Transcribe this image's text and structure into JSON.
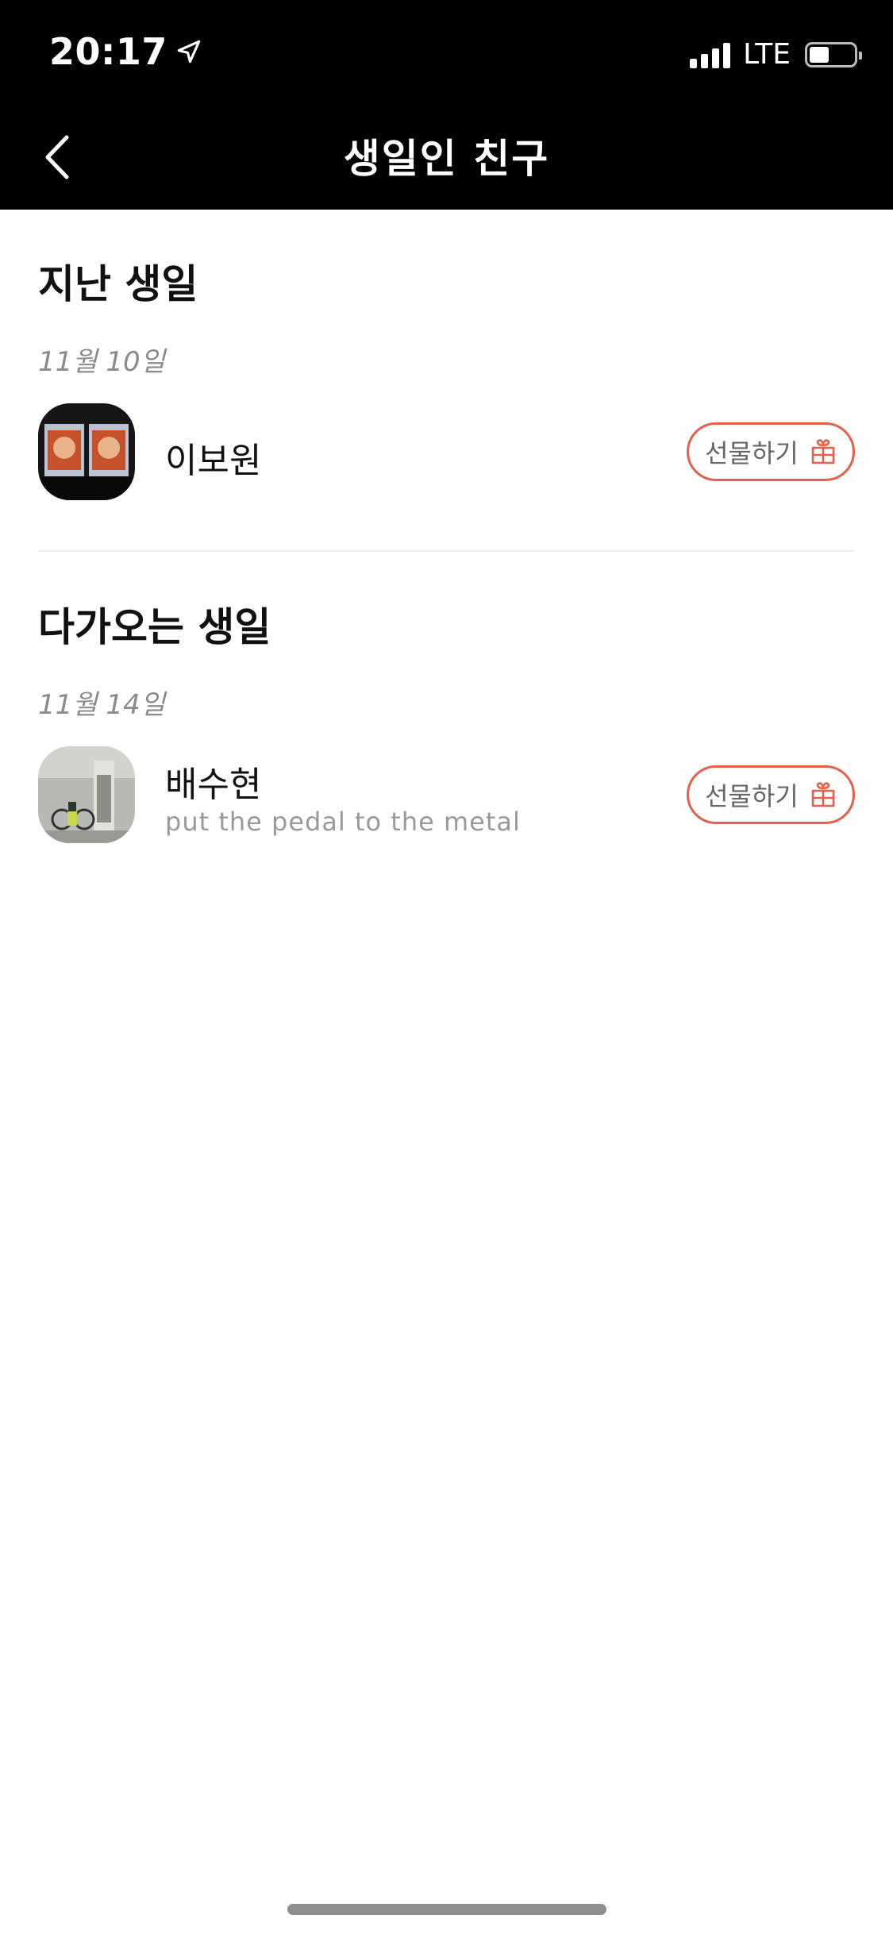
{
  "status_bar": {
    "time": "20:17",
    "network": "LTE",
    "location_icon": "location-arrow-icon",
    "signal_bars": 4,
    "battery_level": 0.3
  },
  "header": {
    "title": "생일인 친구",
    "back_icon": "chevron-left-icon"
  },
  "sections": [
    {
      "title": "지난 생일",
      "date": "11월 10일",
      "friends": [
        {
          "name": "이보원",
          "status": "",
          "gift_label": "선물하기"
        }
      ]
    },
    {
      "title": "다가오는 생일",
      "date": "11월 14일",
      "friends": [
        {
          "name": "배수현",
          "status": "put the pedal to the metal",
          "gift_label": "선물하기"
        }
      ]
    }
  ],
  "colors": {
    "accent": "#e4604a",
    "header_bg": "#000000",
    "date_text": "#8a8a8a",
    "status_text": "#999999"
  }
}
